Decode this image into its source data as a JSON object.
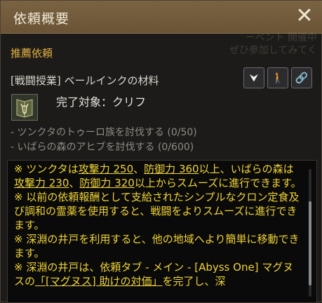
{
  "window": {
    "title": "依頼概要",
    "close_label": "✕",
    "background_text_1": "ーベント 開催中",
    "background_text_2": "ぜひ参加してみてく"
  },
  "recommended": {
    "section_label": "推薦依頼",
    "quest_title": "[戦闘授業] ベールインクの材料",
    "buttons": [
      {
        "icon": "navigate-icon",
        "glyph": "⮟"
      },
      {
        "icon": "walking-person-icon",
        "glyph": "🚶"
      },
      {
        "icon": "link-icon",
        "glyph": "🔗"
      }
    ],
    "target_icon": "deer-head-book-icon",
    "target_label": "完了対象：クリフ",
    "objectives": [
      "- ツンクタのトゥーロ族を討伐する (0/50)",
      "- いばらの森のアヒブを討伐する (0/600)"
    ]
  },
  "description": {
    "p1_a": "※ ツンクタは",
    "p1_atk1": "攻撃力 250",
    "p1_b": "、",
    "p1_def1": "防御力 360",
    "p1_c": "以上、いばらの森は",
    "p1_atk2": "攻撃力 230",
    "p1_d": "、",
    "p1_def2": "防御力 320",
    "p1_e": "以上からスムーズに進行できます。",
    "p2": "※ 以前の依頼報酬として支給されたシンプルなクロン定食及び調和の霊薬を使用すると、戦闘をよりスムーズに進行できます。",
    "p3": "※ 深淵の井戸を利用すると、他の地域へより簡単に移動できます。",
    "p4_a": "※ 深淵の井戸は、依頼タブ - メイン - [Abyss One] マグヌスの",
    "p4_link": "「[マグヌス] 助けの対価」",
    "p4_b": "を完了し、深"
  },
  "colors": {
    "accent": "#e2b043",
    "description_text": "#f0d434",
    "titlebar": "#7a6342"
  }
}
